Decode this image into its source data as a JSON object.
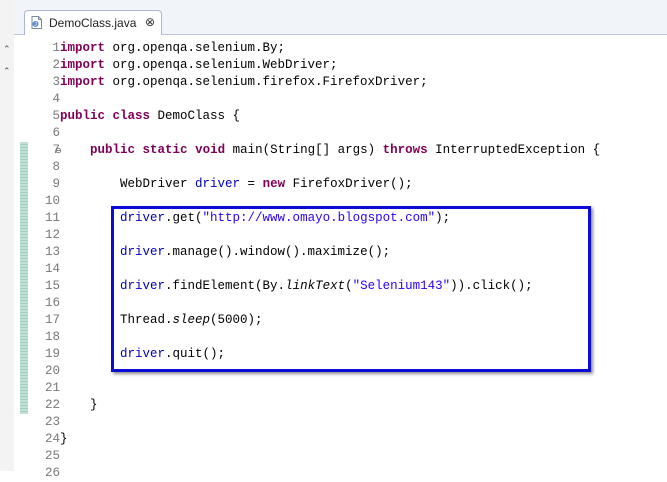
{
  "tab": {
    "title": "DemoClass.java",
    "close_glyph": "⊗"
  },
  "lines": [
    {
      "n": "1",
      "tokens": [
        {
          "t": "import",
          "c": "kw"
        },
        {
          "t": " org.openqa.selenium.By;",
          "c": ""
        }
      ]
    },
    {
      "n": "2",
      "tokens": [
        {
          "t": "import",
          "c": "kw"
        },
        {
          "t": " org.openqa.selenium.WebDriver;",
          "c": ""
        }
      ]
    },
    {
      "n": "3",
      "tokens": [
        {
          "t": "import",
          "c": "kw"
        },
        {
          "t": " org.openqa.selenium.firefox.FirefoxDriver;",
          "c": ""
        }
      ]
    },
    {
      "n": "4",
      "tokens": []
    },
    {
      "n": "5",
      "tokens": [
        {
          "t": "public",
          "c": "kw"
        },
        {
          "t": " ",
          "c": ""
        },
        {
          "t": "class",
          "c": "kw"
        },
        {
          "t": " DemoClass {",
          "c": ""
        }
      ]
    },
    {
      "n": "6",
      "tokens": []
    },
    {
      "n": "7",
      "tokens": [
        {
          "t": "    ",
          "c": ""
        },
        {
          "t": "public",
          "c": "kw"
        },
        {
          "t": " ",
          "c": ""
        },
        {
          "t": "static",
          "c": "kw"
        },
        {
          "t": " ",
          "c": ""
        },
        {
          "t": "void",
          "c": "kw"
        },
        {
          "t": " main(String[] args) ",
          "c": ""
        },
        {
          "t": "throws",
          "c": "kw"
        },
        {
          "t": " InterruptedException {",
          "c": ""
        }
      ]
    },
    {
      "n": "8",
      "tokens": []
    },
    {
      "n": "9",
      "tokens": [
        {
          "t": "        WebDriver ",
          "c": ""
        },
        {
          "t": "driver",
          "c": "fld"
        },
        {
          "t": " = ",
          "c": ""
        },
        {
          "t": "new",
          "c": "kw"
        },
        {
          "t": " FirefoxDriver();",
          "c": ""
        }
      ]
    },
    {
      "n": "10",
      "tokens": []
    },
    {
      "n": "11",
      "tokens": [
        {
          "t": "        ",
          "c": ""
        },
        {
          "t": "driver",
          "c": "fld"
        },
        {
          "t": ".get(",
          "c": ""
        },
        {
          "t": "\"http://www.omayo.blogspot.com\"",
          "c": "str"
        },
        {
          "t": ");",
          "c": ""
        }
      ]
    },
    {
      "n": "12",
      "tokens": []
    },
    {
      "n": "13",
      "tokens": [
        {
          "t": "        ",
          "c": ""
        },
        {
          "t": "driver",
          "c": "fld"
        },
        {
          "t": ".manage().window().maximize();",
          "c": ""
        }
      ]
    },
    {
      "n": "14",
      "tokens": []
    },
    {
      "n": "15",
      "tokens": [
        {
          "t": "        ",
          "c": ""
        },
        {
          "t": "driver",
          "c": "fld"
        },
        {
          "t": ".findElement(By.",
          "c": ""
        },
        {
          "t": "linkText",
          "c": "ital"
        },
        {
          "t": "(",
          "c": ""
        },
        {
          "t": "\"Selenium143\"",
          "c": "str"
        },
        {
          "t": ")).click();",
          "c": ""
        }
      ]
    },
    {
      "n": "16",
      "tokens": []
    },
    {
      "n": "17",
      "tokens": [
        {
          "t": "        Thread.",
          "c": ""
        },
        {
          "t": "sleep",
          "c": "ital"
        },
        {
          "t": "(5000);",
          "c": ""
        }
      ]
    },
    {
      "n": "18",
      "tokens": []
    },
    {
      "n": "19",
      "tokens": [
        {
          "t": "        ",
          "c": ""
        },
        {
          "t": "driver",
          "c": "fld"
        },
        {
          "t": ".quit();",
          "c": ""
        }
      ]
    },
    {
      "n": "20",
      "tokens": []
    },
    {
      "n": "21",
      "tokens": []
    },
    {
      "n": "22",
      "tokens": [
        {
          "t": "    }",
          "c": ""
        }
      ]
    },
    {
      "n": "23",
      "tokens": []
    },
    {
      "n": "24",
      "tokens": [
        {
          "t": "}",
          "c": ""
        }
      ]
    },
    {
      "n": "25",
      "tokens": []
    },
    {
      "n": "26",
      "tokens": []
    }
  ],
  "fold_line": "7",
  "colors": {
    "keyword": "#7f0055",
    "field": "#0000c0",
    "string": "#2a00ff",
    "highlight": "#0c0cd6"
  }
}
